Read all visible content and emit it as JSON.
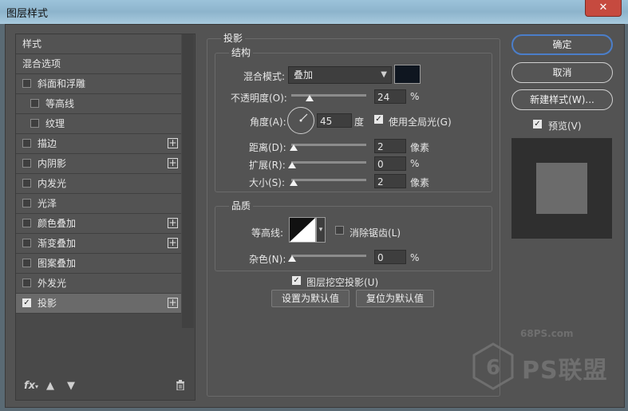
{
  "window": {
    "title": "图层样式",
    "close_label": "✕"
  },
  "left_panel": {
    "items": [
      {
        "label": "样式",
        "checkbox": false,
        "checked": false,
        "plus": false,
        "indent": 0
      },
      {
        "label": "混合选项",
        "checkbox": false,
        "checked": false,
        "plus": false,
        "indent": 0
      },
      {
        "label": "斜面和浮雕",
        "checkbox": true,
        "checked": false,
        "plus": false,
        "indent": 0
      },
      {
        "label": "等高线",
        "checkbox": true,
        "checked": false,
        "plus": false,
        "indent": 1
      },
      {
        "label": "纹理",
        "checkbox": true,
        "checked": false,
        "plus": false,
        "indent": 1
      },
      {
        "label": "描边",
        "checkbox": true,
        "checked": false,
        "plus": true,
        "indent": 0
      },
      {
        "label": "内阴影",
        "checkbox": true,
        "checked": false,
        "plus": true,
        "indent": 0
      },
      {
        "label": "内发光",
        "checkbox": true,
        "checked": false,
        "plus": false,
        "indent": 0
      },
      {
        "label": "光泽",
        "checkbox": true,
        "checked": false,
        "plus": false,
        "indent": 0
      },
      {
        "label": "颜色叠加",
        "checkbox": true,
        "checked": false,
        "plus": true,
        "indent": 0
      },
      {
        "label": "渐变叠加",
        "checkbox": true,
        "checked": false,
        "plus": true,
        "indent": 0
      },
      {
        "label": "图案叠加",
        "checkbox": true,
        "checked": false,
        "plus": false,
        "indent": 0
      },
      {
        "label": "外发光",
        "checkbox": true,
        "checked": false,
        "plus": false,
        "indent": 0
      },
      {
        "label": "投影",
        "checkbox": true,
        "checked": true,
        "plus": true,
        "indent": 0,
        "selected": true
      }
    ],
    "bottom_icons": [
      "fx-icon",
      "arrow-up-icon",
      "arrow-down-icon",
      "trash-icon"
    ],
    "fx_label": "fx"
  },
  "drop_shadow": {
    "section_title": "投影",
    "structure": {
      "title": "结构",
      "blend_mode_label": "混合模式:",
      "blend_mode_value": "叠加",
      "color": "#0f1620",
      "opacity_label": "不透明度(O):",
      "opacity_value": "24",
      "opacity_unit": "%",
      "opacity_level": 24,
      "angle_label": "角度(A):",
      "angle_value": "45",
      "angle_unit": "度",
      "global_light_label": "使用全局光(G)",
      "global_light_checked": true,
      "distance_label": "距离(D):",
      "distance_value": "2",
      "distance_unit": "像素",
      "spread_label": "扩展(R):",
      "spread_value": "0",
      "spread_unit": "%",
      "size_label": "大小(S):",
      "size_value": "2",
      "size_unit": "像素"
    },
    "quality": {
      "title": "品质",
      "contour_label": "等高线:",
      "anti_alias_label": "消除锯齿(L)",
      "anti_alias_checked": false,
      "noise_label": "杂色(N):",
      "noise_value": "0",
      "noise_unit": "%"
    },
    "knockout_label": "图层挖空投影(U)",
    "knockout_checked": true,
    "make_default_label": "设置为默认值",
    "reset_default_label": "复位为默认值"
  },
  "right_panel": {
    "ok_label": "确定",
    "cancel_label": "取消",
    "new_style_label": "新建样式(W)...",
    "preview_label": "预览(V)",
    "preview_checked": true
  },
  "watermark": {
    "site": "68PS.com",
    "brand": "PS联盟"
  },
  "colors": {
    "dialog_bg": "#535353",
    "accent": "#4b7ec9",
    "selected_row": "#6a6a6a"
  }
}
